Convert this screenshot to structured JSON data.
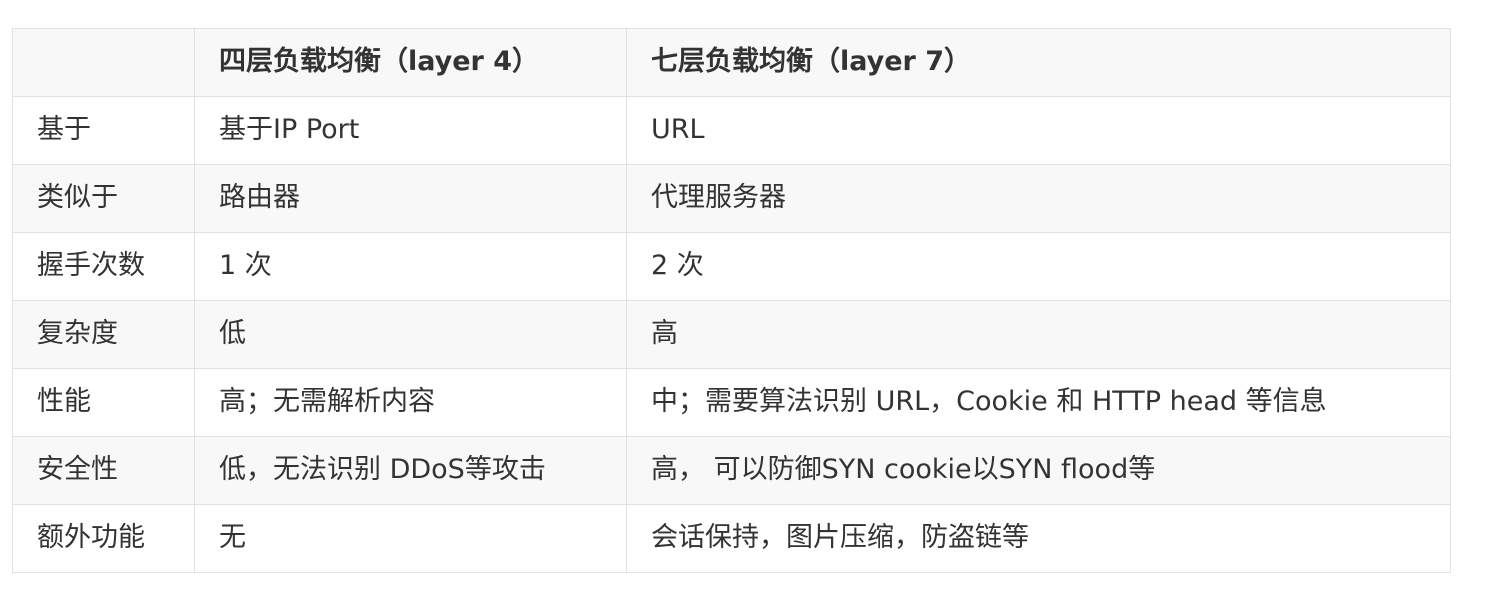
{
  "table": {
    "headers": [
      "",
      "四层负载均衡（layer 4）",
      "七层负载均衡（layer 7）"
    ],
    "rows": [
      [
        "基于",
        "基于IP  Port",
        "URL"
      ],
      [
        "类似于",
        "路由器",
        "代理服务器"
      ],
      [
        "握手次数",
        "1 次",
        "2 次"
      ],
      [
        "复杂度",
        "低",
        "高"
      ],
      [
        "性能",
        "高；无需解析内容",
        "中；需要算法识别 URL，Cookie 和 HTTP head 等信息"
      ],
      [
        "安全性",
        "低，无法识别 DDoS等攻击",
        "高， 可以防御SYN cookie以SYN flood等"
      ],
      [
        "额外功能",
        "无",
        "会话保持，图片压缩，防盗链等"
      ]
    ]
  },
  "colors": {
    "border": "#dfe2e5",
    "stripe": "#f8f8f8",
    "text": "#333333"
  }
}
